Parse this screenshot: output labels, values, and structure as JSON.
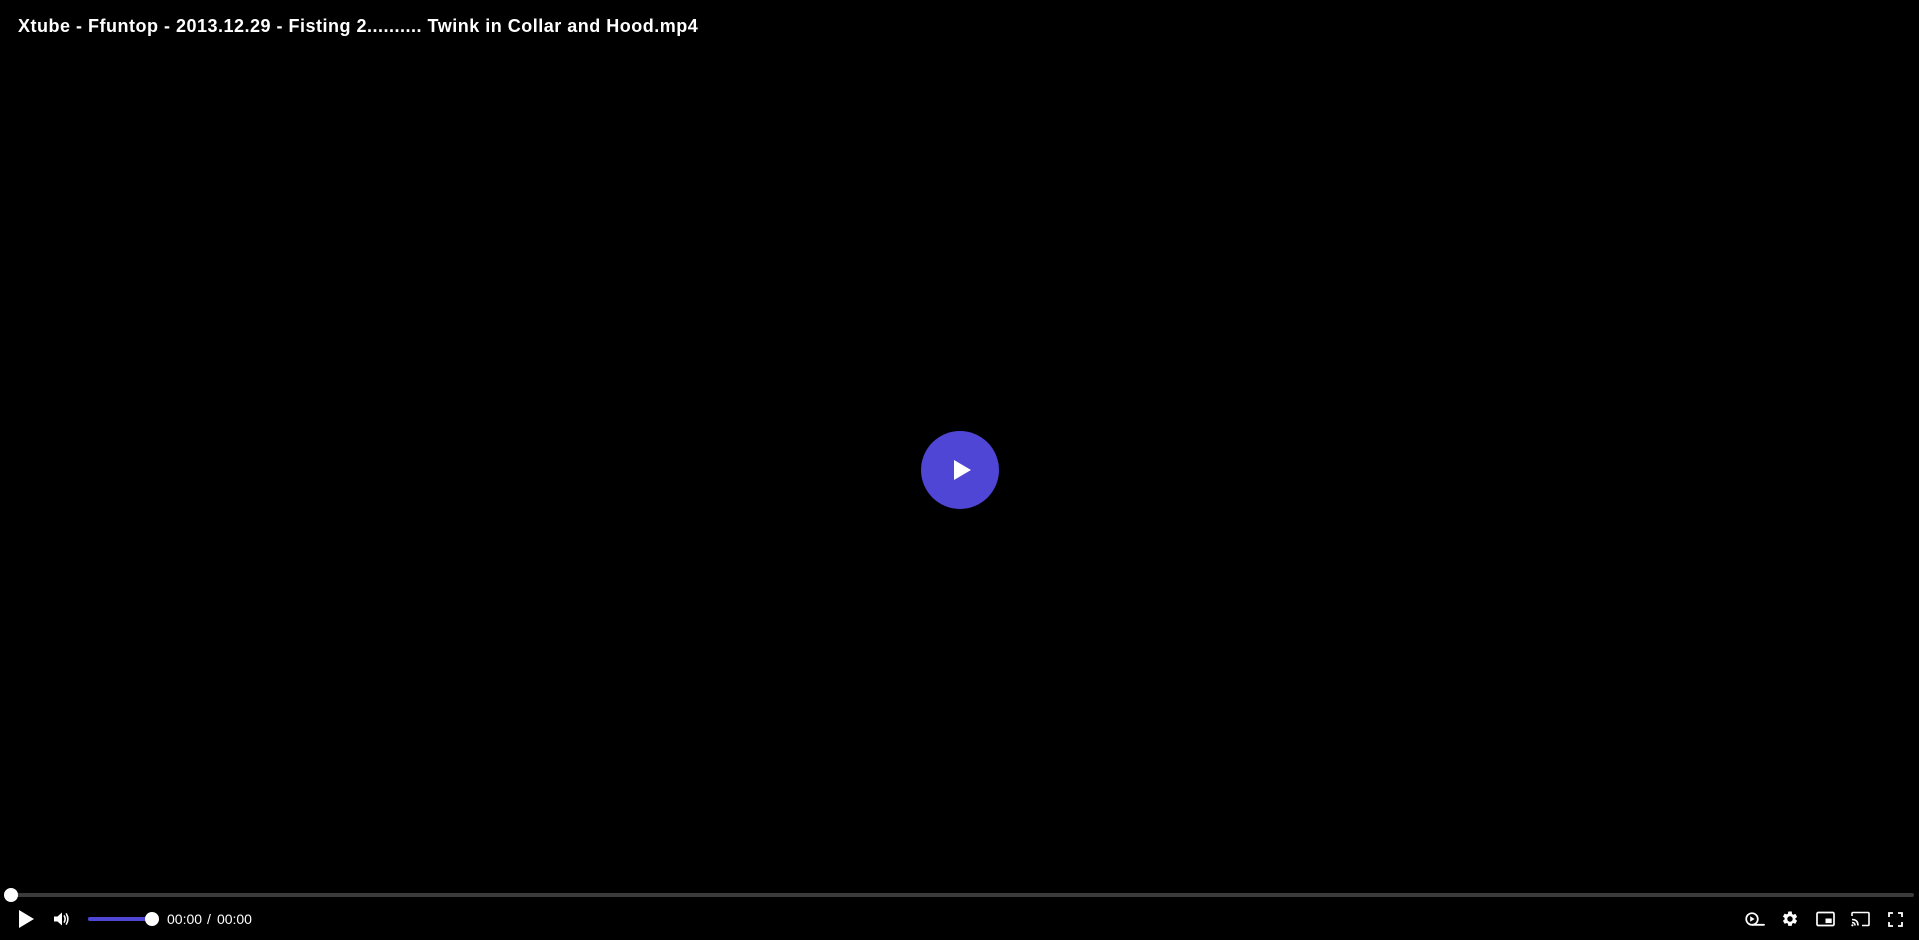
{
  "video": {
    "title": "Xtube - Ffuntop - 2013.12.29 - Fisting 2.......... Twink in Collar and Hood.mp4"
  },
  "playback": {
    "current_time": "00:00",
    "separator": "/",
    "duration": "00:00",
    "progress_fraction": 0
  },
  "volume": {
    "level_fraction": 1
  },
  "icons": {
    "big_play": "play-icon",
    "play": "play-icon",
    "mute": "volume-icon",
    "speed": "playback-speed-icon",
    "settings": "gear-icon",
    "pip": "picture-in-picture-icon",
    "cast": "cast-icon",
    "fullscreen": "fullscreen-icon"
  },
  "colors": {
    "accent": "#4f46d6",
    "background": "#000000",
    "track": "#3a3a3a",
    "text": "#ffffff"
  }
}
